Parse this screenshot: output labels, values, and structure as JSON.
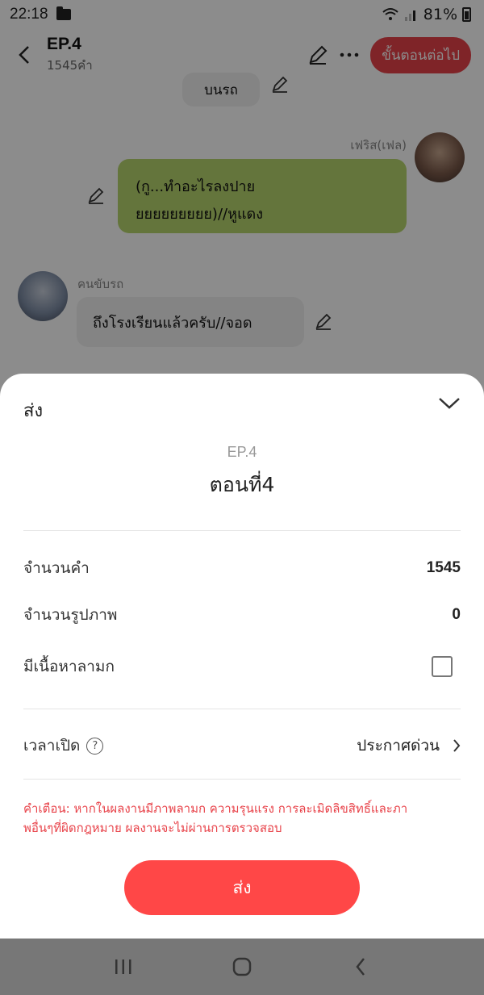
{
  "status_bar": {
    "time": "22:18",
    "battery": "81%"
  },
  "header": {
    "title": "EP.4",
    "subtitle": "1545คำ",
    "next_button": "ขั้นตอนต่อไป"
  },
  "chat": {
    "top_bubble": "บนรถ",
    "right_name": "เฟริส(เฟล)",
    "right_message_line1": "(กู...ทำอะไรลงปาย",
    "right_message_line2": "ยยยยยยยยย)//หูแดง",
    "left_name": "คนขับรถ",
    "left_message": "ถึงโรงเรียนแล้วครับ//จอด"
  },
  "sheet": {
    "title": "ส่ง",
    "ep_small": "EP.4",
    "ep_name": "ตอนที่4",
    "rows": {
      "word_count_label": "จำนวนคำ",
      "word_count_value": "1545",
      "image_count_label": "จำนวนรูปภาพ",
      "image_count_value": "0",
      "mature_label": "มีเนื้อหาลามก",
      "publish_time_label": "เวลาเปิด",
      "publish_time_value": "ประกาศด่วน"
    },
    "warning_line1": "คำเตือน: หากในผลงานมีภาพลามก ความรุนแรง การละเมิดลิขสิทธิ์และภา",
    "warning_line2": "พอื่นๆที่ผิดกฎหมาย ผลงานจะไม่ผ่านการตรวจสอบ",
    "send_button": "ส่ง"
  },
  "colors": {
    "accent": "#e8434a",
    "send_button": "#ff4747",
    "green_bubble": "#b7d66d"
  },
  "icons": [
    "back-icon",
    "edit-icon",
    "more-icon",
    "chevron-down-icon",
    "help-icon",
    "chevron-right-icon",
    "recents-icon",
    "home-icon",
    "back-nav-icon"
  ]
}
